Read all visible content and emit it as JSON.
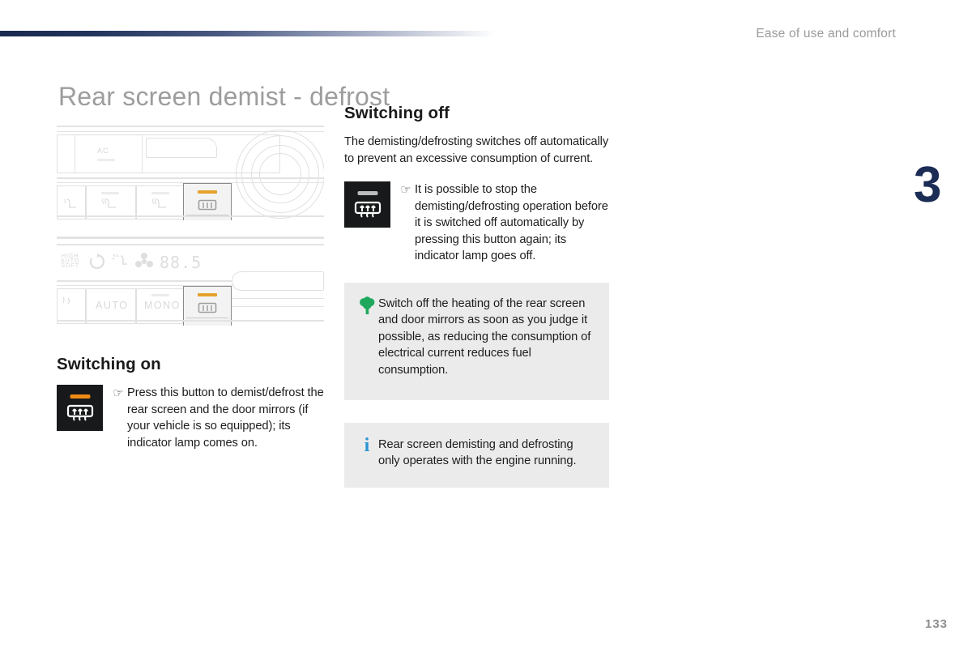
{
  "header": {
    "section_label": "Ease of use and comfort",
    "rule_color_start": "#19294f",
    "rule_color_end": "#ffffff"
  },
  "chapter": {
    "number": "3",
    "color": "#1b2c55"
  },
  "page": {
    "number": "133",
    "title": "Rear screen demist - defrost",
    "title_color": "#9d9d9d"
  },
  "illustrations": [
    {
      "name": "climate-panel-manual",
      "labels": [
        "AC"
      ],
      "highlighted_control": "rear-screen-demist-button",
      "lamp_color": "#e5a22c"
    },
    {
      "name": "climate-panel-automatic",
      "labels": [
        "AUTO",
        "MONO",
        "88.5"
      ],
      "display_indicators": [
        "AUTO",
        "recirculation",
        "air-distribution",
        "fan",
        "temperature"
      ],
      "highlighted_control": "rear-screen-demist-button",
      "lamp_color": "#e5a22c"
    }
  ],
  "sections": {
    "switching_off": {
      "heading": "Switching off",
      "paragraph": "The demisting/defrosting switches off automatically to prevent an excessive consumption of current.",
      "button": {
        "name": "rear-screen-demist-button",
        "lamp_state": "off",
        "lamp_color": "#b9bcbe",
        "marker": "☞",
        "text": "It is possible to stop the demisting/defrosting operation before it is switched off automatically by pressing this button again; its indicator lamp goes off."
      }
    },
    "switching_on": {
      "heading": "Switching on",
      "button": {
        "name": "rear-screen-demist-button",
        "lamp_state": "on",
        "lamp_color": "#ef8b16",
        "marker": "☞",
        "text": "Press this button to demist/defrost the rear screen and the door mirrors (if your vehicle is so equipped); its indicator lamp comes on."
      }
    }
  },
  "tips": {
    "eco": {
      "icon": "tree-icon",
      "icon_color": "#1fa85c",
      "background": "#ebebeb",
      "text": "Switch off the heating of the rear screen and door mirrors as soon as you judge it possible, as reducing the consumption of electrical current reduces fuel consumption."
    },
    "info": {
      "icon": "info-icon",
      "icon_color": "#2b95d6",
      "background": "#ebebeb",
      "glyph": "i",
      "text": "Rear screen demisting and defrosting only operates with the engine running."
    }
  }
}
